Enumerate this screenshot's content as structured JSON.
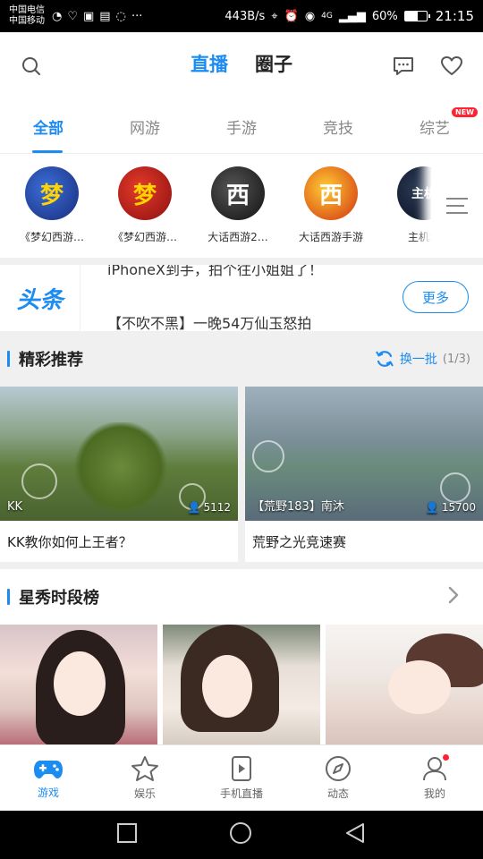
{
  "status_bar": {
    "carrier_line1": "中国电信",
    "carrier_line2": "中国移动",
    "speed": "443B/s",
    "network": "4G",
    "battery": "60%",
    "battery_level": 0.6,
    "time": "21:15"
  },
  "header": {
    "tabs": [
      "直播",
      "圈子"
    ],
    "active_tab": "直播",
    "left_icon": "search-icon",
    "right_icons": [
      "message-icon",
      "heart-icon"
    ]
  },
  "categories": {
    "items": [
      "全部",
      "网游",
      "手游",
      "竞技",
      "综艺"
    ],
    "active": "全部",
    "new_badge": "NEW"
  },
  "games": [
    {
      "label": "《梦幻西游…",
      "icon_char": "梦"
    },
    {
      "label": "《梦幻西游…",
      "icon_char": "梦"
    },
    {
      "label": "大话西游2…",
      "icon_char": "西"
    },
    {
      "label": "大话西游手游",
      "icon_char": "西"
    },
    {
      "label": "主机游",
      "icon_char": "主机"
    }
  ],
  "news": {
    "logo": "头条",
    "line1": "iPhoneX到手，拍个往小姐姐了！",
    "line2": "【不吹不黑】一晚54万仙玉怒拍",
    "more_label": "更多"
  },
  "recommend": {
    "title": "精彩推荐",
    "swap_label": "换一批",
    "swap_count": "(1/3)",
    "cards": [
      {
        "streamer": "KK",
        "viewers": "5112",
        "title": "KK教你如何上王者？"
      },
      {
        "streamer": "【荒野183】南沐",
        "viewers": "15700",
        "title": "荒野之光竞速赛"
      }
    ]
  },
  "star_section": {
    "title": "星秀时段榜"
  },
  "bottom_nav": [
    {
      "label": "游戏",
      "icon": "gamepad-icon",
      "active": true
    },
    {
      "label": "娱乐",
      "icon": "star-icon",
      "active": false
    },
    {
      "label": "手机直播",
      "icon": "phone-play-icon",
      "active": false
    },
    {
      "label": "动态",
      "icon": "compass-icon",
      "active": false
    },
    {
      "label": "我的",
      "icon": "user-icon",
      "active": false
    }
  ],
  "colors": {
    "accent": "#1d8cf0",
    "badge_red": "#ff2233",
    "section_bg": "#f0f0f0"
  }
}
